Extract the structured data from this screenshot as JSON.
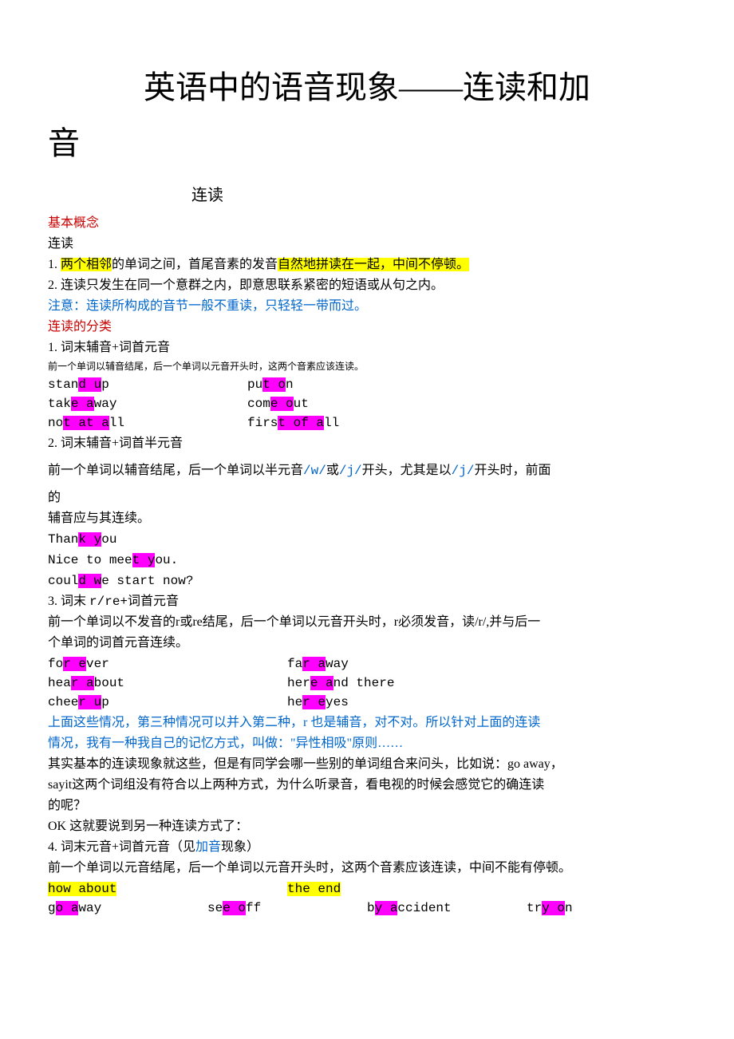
{
  "title": {
    "line1": "英语中的语音现象——连读和加",
    "line2": "音"
  },
  "subtitle": "连读",
  "s1": {
    "heading": "基本概念",
    "line1": "连读",
    "rule1_prefix": "1. ",
    "rule1_hl1": "两个相邻",
    "rule1_mid": "的单词之间，首尾音素的发音",
    "rule1_hl2": "自然地拼读在一起，中间不停顿。",
    "rule2": "2. 连读只发生在同一个意群之内，即意思联系紧密的短语或从句之内。",
    "note": "注意：连读所构成的音节一般不重读，只轻轻一带而过。"
  },
  "s2": {
    "heading": "连读的分类",
    "r1": {
      "title": "1. 词末辅音+词首元音",
      "sub": "前一个单词以辅音结尾，后一个单词以元音开头时，这两个音素应该连读。",
      "e1a": "stan",
      "e1b": "d u",
      "e1c": "p",
      "e1d": "pu",
      "e1e": "t o",
      "e1f": "n",
      "e2a": "tak",
      "e2b": "e a",
      "e2c": "way",
      "e2d": "com",
      "e2e": "e o",
      "e2f": "ut",
      "e3a": "no",
      "e3b": "t at a",
      "e3c": "ll",
      "e3d": "firs",
      "e3e": "t of a",
      "e3f": "ll"
    },
    "r2": {
      "title": "2. 词末辅音+词首半元音",
      "sub_a": "前一个单词以辅音结尾，后一个单词以半元音",
      "sub_w": "/w/",
      "sub_b": "或",
      "sub_j1": "/j/",
      "sub_c": "开头，尤其是以",
      "sub_j2": "/j/",
      "sub_d": "开头时，前面",
      "sub_e": "的",
      "sub_f": "辅音应与其连续。",
      "e1a": "Than",
      "e1b": "k y",
      "e1c": "ou",
      "e2a": "Nice to mee",
      "e2b": "t y",
      "e2c": "ou.",
      "e3a": "coul",
      "e3b": "d w",
      "e3c": "e start now?"
    },
    "r3": {
      "title_a": "3. 词末 ",
      "title_b": "r/re+",
      "title_c": "词首元音",
      "sub1": "前一个单词以不发音的r或re结尾，后一个单词以元音开头时，r必须发音，读/r/,并与后一",
      "sub2": "个单词的词首元音连续。",
      "e1a": "fo",
      "e1b": "r e",
      "e1c": "ver",
      "e1d": "fa",
      "e1e": "r a",
      "e1f": "way",
      "e2a": "hea",
      "e2b": "r a",
      "e2c": "bout",
      "e2d": "her",
      "e2e": "e a",
      "e2f": "nd there",
      "e3a": "chee",
      "e3b": "r u",
      "e3c": "p",
      "e3d": "he",
      "e3e": "r e",
      "e3f": "yes",
      "note1": "上面这些情况，第三种情况可以并入第二种，r 也是辅音，对不对。所以针对上面的连读",
      "note2": "情况，我有一种我自己的记忆方式，叫做：\"异性相吸\"原则……",
      "p1": "其实基本的连读现象就这些，但是有同学会哪一些别的单词组合来问头，比如说：go away，",
      "p2": "sayit这两个词组没有符合以上两种方式，为什么听录音，看电视的时候会感觉它的确连读",
      "p3": "的呢？",
      "p4": "OK 这就要说到另一种连读方式了："
    },
    "r4": {
      "title_a": "4. 词末元音+词首元音（见",
      "title_b": "加音",
      "title_c": "现象）",
      "sub": "前一个单词以元音结尾，后一个单词以元音开头时，这两个音素应该连读，中间不能有停顿。",
      "e1a": "how about",
      "e1b": "the end",
      "e2a": "g",
      "e2b": "o a",
      "e2c": "way",
      "e2d": "se",
      "e2e": "e o",
      "e2f": "ff",
      "e2g": "b",
      "e2h": "y a",
      "e2i": "ccident",
      "e2j": "tr",
      "e2k": "y o",
      "e2l": "n"
    }
  }
}
